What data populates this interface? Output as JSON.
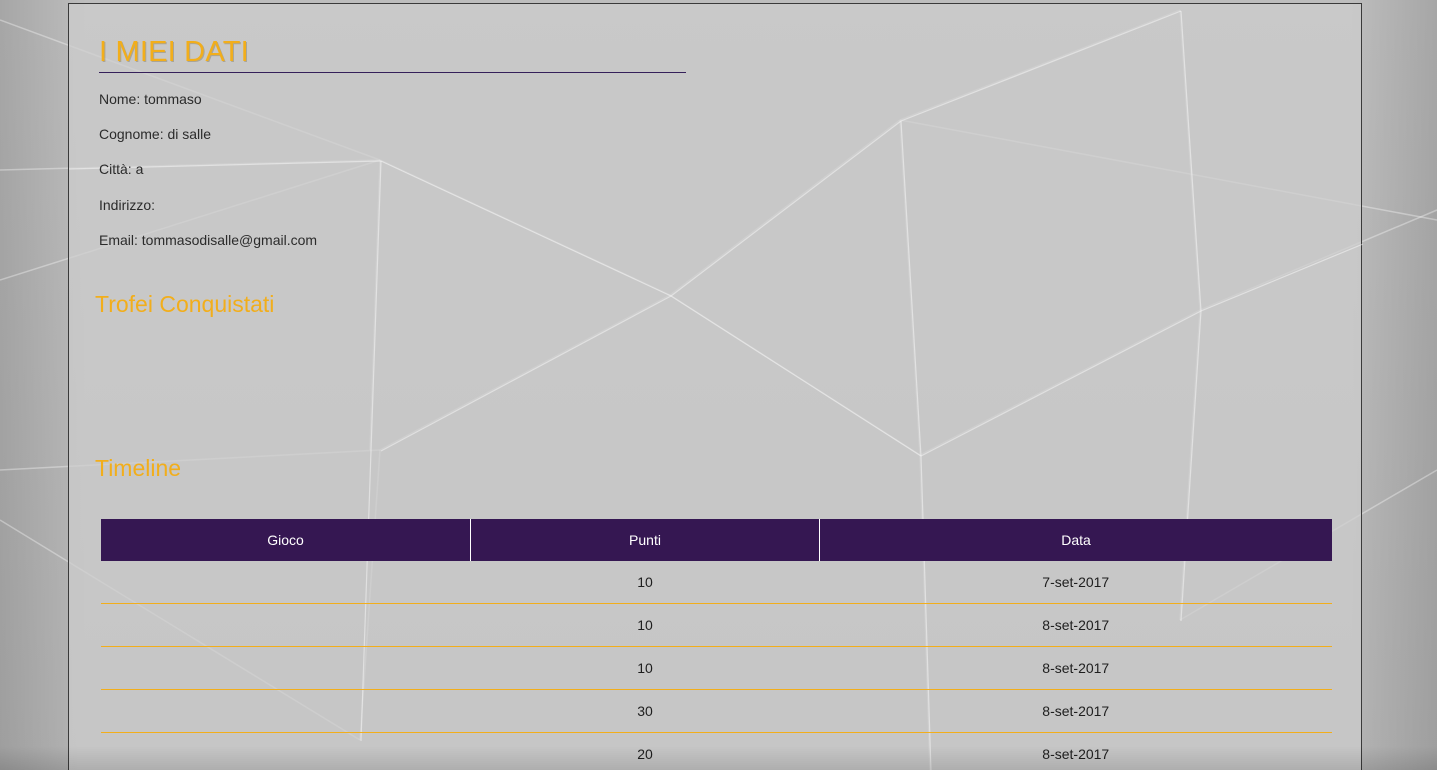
{
  "profile": {
    "title": "I MIEI DATI",
    "nome": "Nome: tommaso",
    "cognome": "Cognome: di salle",
    "citta": "Città: a",
    "indirizzo": "Indirizzo:",
    "email": "Email: tommasodisalle@gmail.com"
  },
  "trofei": {
    "title": "Trofei Conquistati"
  },
  "timeline": {
    "title": "Timeline",
    "headers": [
      "Gioco",
      "Punti",
      "Data"
    ],
    "rows": [
      {
        "gioco": "",
        "punti": "10",
        "data": "7-set-2017"
      },
      {
        "gioco": "",
        "punti": "10",
        "data": "8-set-2017"
      },
      {
        "gioco": "",
        "punti": "10",
        "data": "8-set-2017"
      },
      {
        "gioco": "",
        "punti": "30",
        "data": "8-set-2017"
      },
      {
        "gioco": "",
        "punti": "20",
        "data": "8-set-2017"
      }
    ]
  },
  "colors": {
    "accent": "#f2ae1b",
    "header_bg": "#351752",
    "text": "#2b2b2b"
  }
}
